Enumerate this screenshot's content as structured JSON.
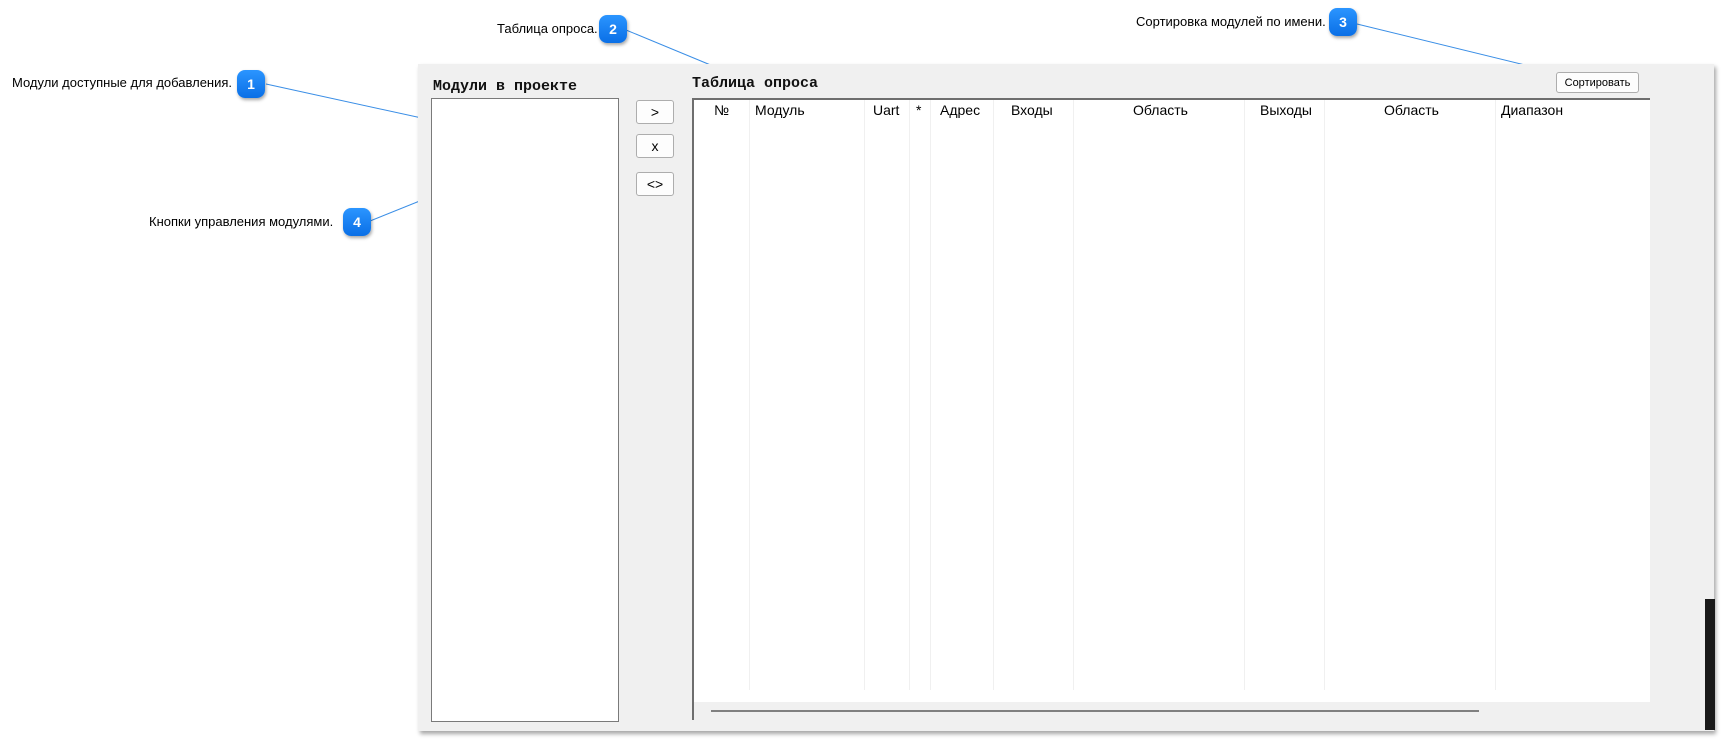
{
  "callouts": [
    {
      "number": "1",
      "label": "Модули доступные для добавления."
    },
    {
      "number": "2",
      "label": "Таблица опроса."
    },
    {
      "number": "3",
      "label": "Сортировка модулей по имени."
    },
    {
      "number": "4",
      "label": "Кнопки управления модулями."
    }
  ],
  "accent_color": "#1e88ff",
  "panel": {
    "modules_title": "Модули в проекте",
    "table_title": "Таблица опроса",
    "buttons": {
      "add": ">",
      "remove": "x",
      "swap": "<>"
    },
    "sort_button": "Сортировать",
    "table": {
      "columns": [
        "№",
        "Модуль",
        "Uart",
        "*",
        "Адрес",
        "Входы",
        "Область",
        "Выходы",
        "Область",
        "Диапазон"
      ],
      "rows": []
    }
  }
}
